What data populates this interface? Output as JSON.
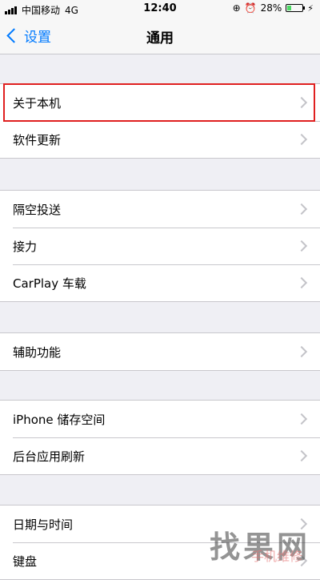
{
  "status_bar": {
    "carrier": "中国移动",
    "network": "4G",
    "time": "12:40",
    "battery_percent": "28%",
    "battery_level": 0.28
  },
  "nav": {
    "back_label": "设置",
    "title": "通用"
  },
  "groups": [
    {
      "items": [
        {
          "label": "关于本机"
        },
        {
          "label": "软件更新"
        }
      ]
    },
    {
      "items": [
        {
          "label": "隔空投送"
        },
        {
          "label": "接力"
        },
        {
          "label": "CarPlay 车载"
        }
      ]
    },
    {
      "items": [
        {
          "label": "辅助功能"
        }
      ]
    },
    {
      "items": [
        {
          "label": "iPhone 储存空间"
        },
        {
          "label": "后台应用刷新"
        }
      ]
    },
    {
      "items": [
        {
          "label": "日期与时间"
        },
        {
          "label": "键盘"
        }
      ]
    }
  ],
  "watermark": {
    "text": "找果网",
    "sub_text": "手机维修"
  }
}
